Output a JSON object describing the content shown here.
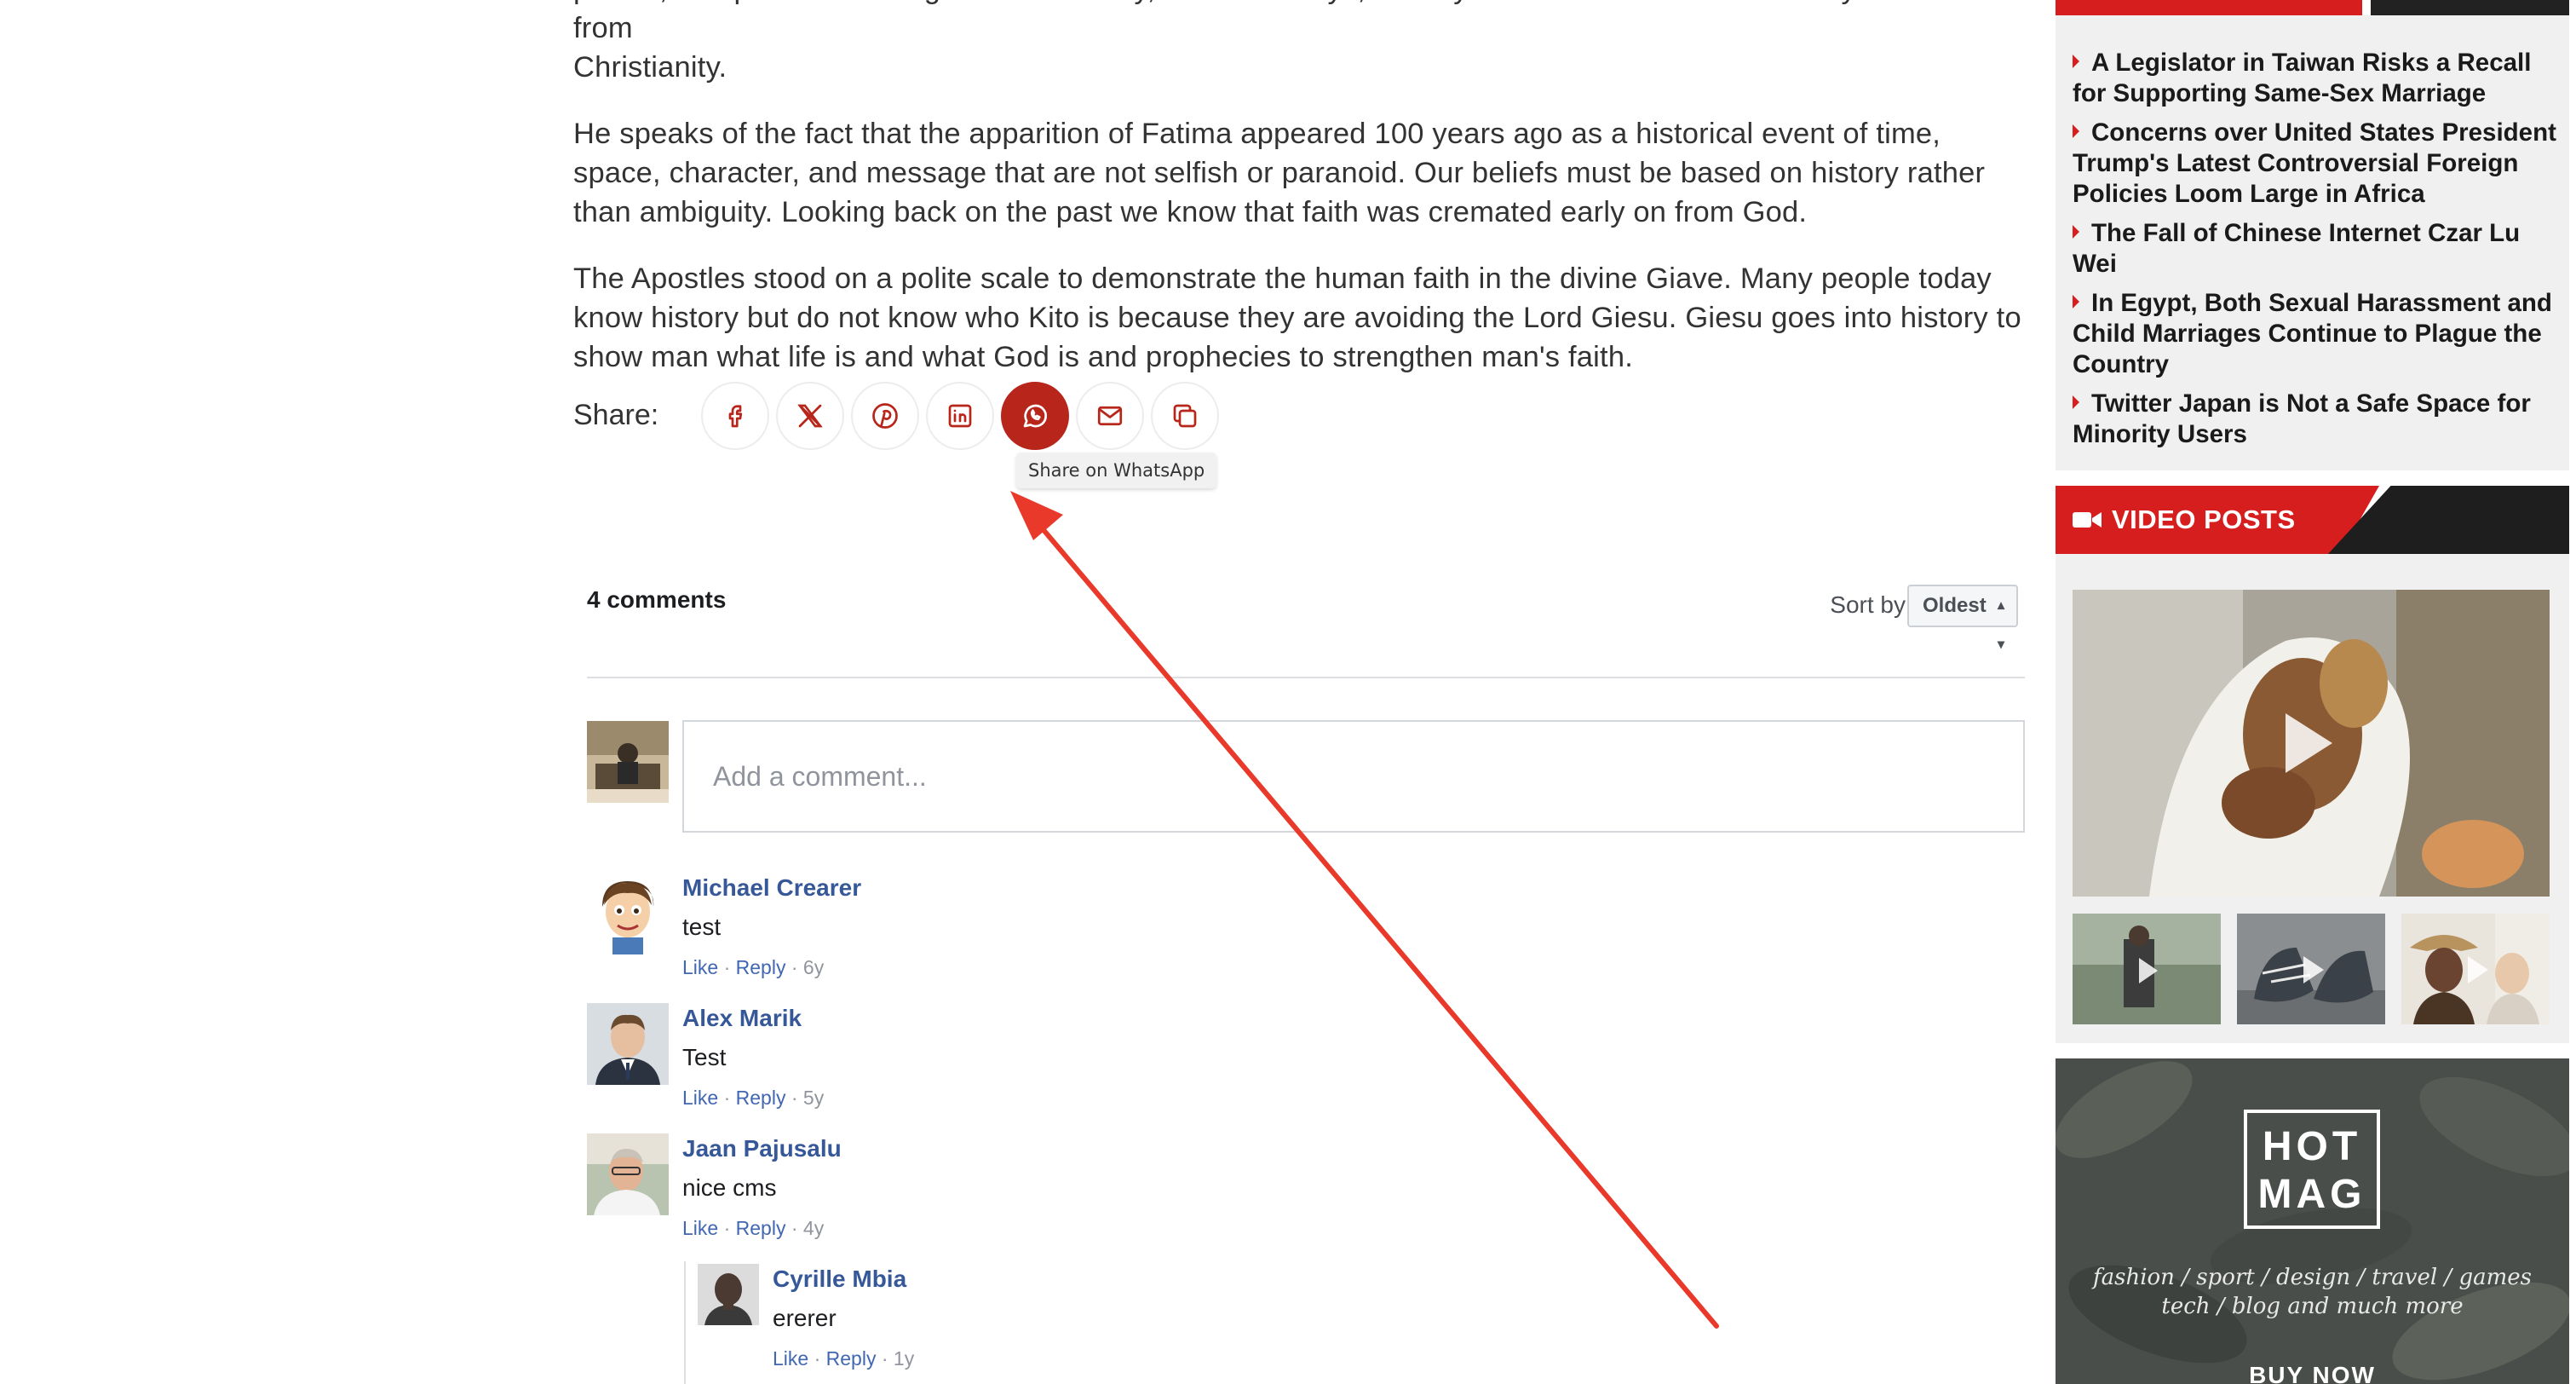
{
  "article": {
    "paragraphs": [
      "places, and places. Looking back on history, social holidays, holidays ... are related to Christianity and come from",
      "Christianity.",
      "He speaks of the fact that the apparition of Fatima appeared 100 years ago as a historical event of time, space, character, and message that are not selfish or paranoid. Our beliefs must be based on history rather than ambiguity. Looking back on the past we know that faith was cremated early on from God.",
      "The Apostles stood on a polite scale to demonstrate the human faith in the divine Giave. Many people today know history but do not know who Kito is because they are avoiding the Lord Giesu. Giesu goes into history to show man what life is and what God is and prophecies to strengthen man's faith."
    ]
  },
  "share": {
    "label": "Share:",
    "buttons": [
      {
        "icon": "facebook-icon"
      },
      {
        "icon": "x-icon"
      },
      {
        "icon": "pinterest-icon"
      },
      {
        "icon": "linkedin-icon"
      },
      {
        "icon": "whatsapp-icon"
      },
      {
        "icon": "email-icon"
      },
      {
        "icon": "copy-icon"
      }
    ],
    "tooltip": "Share on WhatsApp",
    "active_color": "#b8261b"
  },
  "comments": {
    "count_label": "4 comments",
    "sort_label": "Sort by",
    "sort_value": "Oldest",
    "placeholder": "Add a comment...",
    "like_label": "Like",
    "reply_label": "Reply",
    "items": [
      {
        "author": "Michael Crearer",
        "text": "test",
        "age": "6y"
      },
      {
        "author": "Alex Marik",
        "text": "Test",
        "age": "5y"
      },
      {
        "author": "Jaan Pajusalu",
        "text": "nice cms",
        "age": "4y"
      },
      {
        "author": "Cyrille Mbia",
        "text": "ererer",
        "age": "1y"
      }
    ],
    "link_color": "#4267b2"
  },
  "sidebar": {
    "news": [
      "A Legislator in Taiwan Risks a Recall for Supporting Same-Sex Marriage",
      "Concerns over United States President Trump's Latest Controversial Foreign Policies Loom Large in Africa",
      "The Fall of Chinese Internet Czar Lu Wei",
      "In Egypt, Both Sexual Harassment and Child Marriages Continue to Plague the Country",
      "Twitter Japan is Not a Safe Space for Minority Users"
    ],
    "video_title": "VIDEO POSTS",
    "ad": {
      "logo_line1": "HOT",
      "logo_line2": "MAG",
      "tagline_1": "fashion / sport / design / travel / games",
      "tagline_2": "tech / blog and much more",
      "cta": "BUY NOW"
    },
    "accent_color": "#d61e1e"
  }
}
